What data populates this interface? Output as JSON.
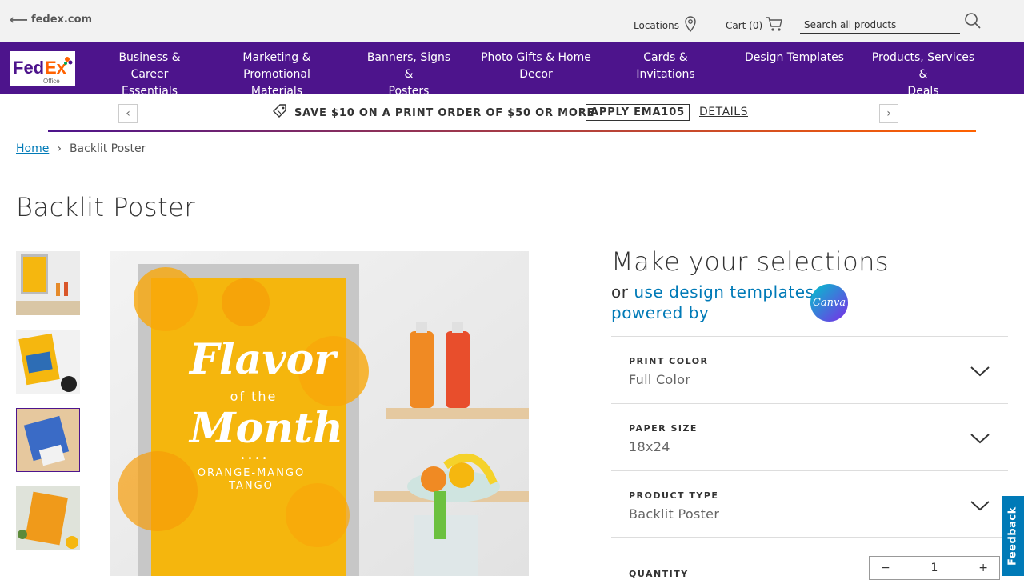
{
  "topbar": {
    "back_label": "fedex.com",
    "locations_label": "Locations",
    "cart_label": "Cart (0)",
    "search_placeholder": "Search all products"
  },
  "nav": {
    "logo_text": "FedEx",
    "logo_sub": "Office",
    "items": [
      {
        "line1": "Business & Career",
        "line2": "Essentials"
      },
      {
        "line1": "Marketing &",
        "line2": "Promotional Materials"
      },
      {
        "line1": "Banners, Signs &",
        "line2": "Posters"
      },
      {
        "line1": "Photo Gifts & Home",
        "line2": "Decor"
      },
      {
        "line1": "Cards & Invitations",
        "line2": ""
      },
      {
        "line1": "Design Templates",
        "line2": ""
      },
      {
        "line1": "Products, Services &",
        "line2": "Deals"
      }
    ]
  },
  "promo": {
    "text": "SAVE $10 ON A PRINT ORDER OF $50 OR MORE",
    "code": "APPLY EMA105",
    "details": "DETAILS"
  },
  "breadcrumb": {
    "home": "Home",
    "current": "Backlit Poster"
  },
  "page_title": "Backlit Poster",
  "poster": {
    "line1": "Flavor",
    "line2": "of the",
    "line3": "Month",
    "dots": "• • • •",
    "sub1": "ORANGE-MANGO",
    "sub2": "TANGO"
  },
  "selections": {
    "title": "Make your selections",
    "or_text": "or",
    "link_text": "use design templates",
    "powered_text": "powered by",
    "canva_label": "Canva",
    "options": [
      {
        "label": "PRINT COLOR",
        "value": "Full Color"
      },
      {
        "label": "PAPER SIZE",
        "value": "18x24"
      },
      {
        "label": "PRODUCT TYPE",
        "value": "Backlit Poster"
      }
    ],
    "quantity_label": "QUANTITY",
    "quantity_value": "1",
    "minus": "−",
    "plus": "+"
  },
  "feedback_label": "Feedback",
  "colors": {
    "brand_purple": "#4d148c",
    "brand_orange": "#ff6200",
    "link_blue": "#007ab7"
  }
}
